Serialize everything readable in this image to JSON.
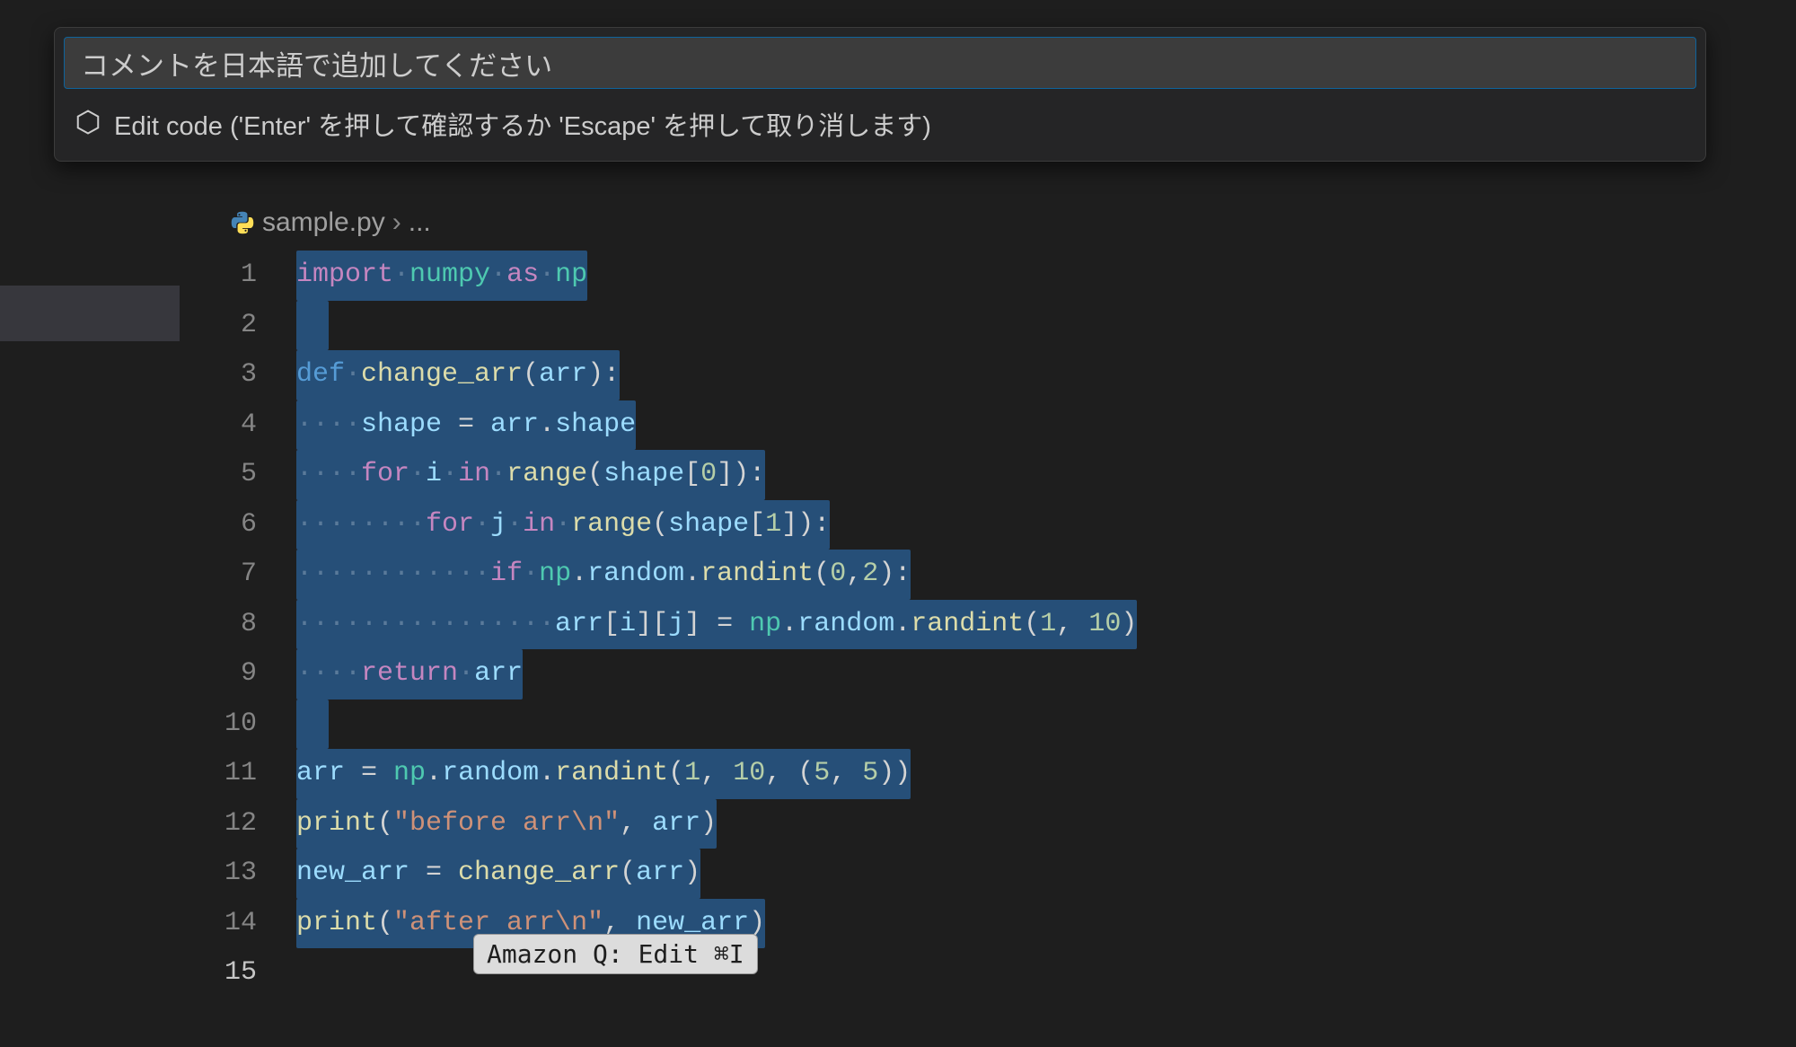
{
  "palette": {
    "input_value": "コメントを日本語で追加してください",
    "hint": "Edit code ('Enter' を押して確認するか 'Escape' を押して取り消します)"
  },
  "breadcrumb": {
    "file": "sample.py",
    "sep": "›",
    "rest": "..."
  },
  "code": {
    "lines": [
      "1",
      "2",
      "3",
      "4",
      "5",
      "6",
      "7",
      "8",
      "9",
      "10",
      "11",
      "12",
      "13",
      "14",
      "15"
    ],
    "l1": {
      "import": "import",
      "numpy": "numpy",
      "as": "as",
      "np": "np"
    },
    "l3": {
      "def": "def",
      "name": "change_arr",
      "arr": "arr"
    },
    "l4": {
      "shape": "shape",
      "eq": " = ",
      "arr": "arr",
      "attr": "shape"
    },
    "l5": {
      "for": "for",
      "i": "i",
      "in": "in",
      "range": "range",
      "shape": "shape",
      "idx": "0"
    },
    "l6": {
      "for": "for",
      "j": "j",
      "in": "in",
      "range": "range",
      "shape": "shape",
      "idx": "1"
    },
    "l7": {
      "if": "if",
      "np": "np",
      "random": "random",
      "randint": "randint",
      "a": "0",
      "b": "2"
    },
    "l8": {
      "arr": "arr",
      "i": "i",
      "j": "j",
      "eq": " = ",
      "np": "np",
      "random": "random",
      "randint": "randint",
      "a": "1",
      "b": "10"
    },
    "l9": {
      "return": "return",
      "arr": "arr"
    },
    "l11": {
      "arr": "arr",
      "eq": " = ",
      "np": "np",
      "random": "random",
      "randint": "randint",
      "a": "1",
      "b": "10",
      "t1": "5",
      "t2": "5"
    },
    "l12": {
      "print": "print",
      "str": "\"before arr\\n\"",
      "arr": "arr"
    },
    "l13": {
      "new_arr": "new_arr",
      "eq": " = ",
      "fn": "change_arr",
      "arr": "arr"
    },
    "l14": {
      "print": "print",
      "str": "\"after arr\\n\"",
      "new_arr": "new_arr"
    }
  },
  "codelens": {
    "label": "Amazon Q: Edit ⌘I"
  },
  "dots4": "····",
  "dots8": "········",
  "dots12": "············",
  "dots16": "················"
}
